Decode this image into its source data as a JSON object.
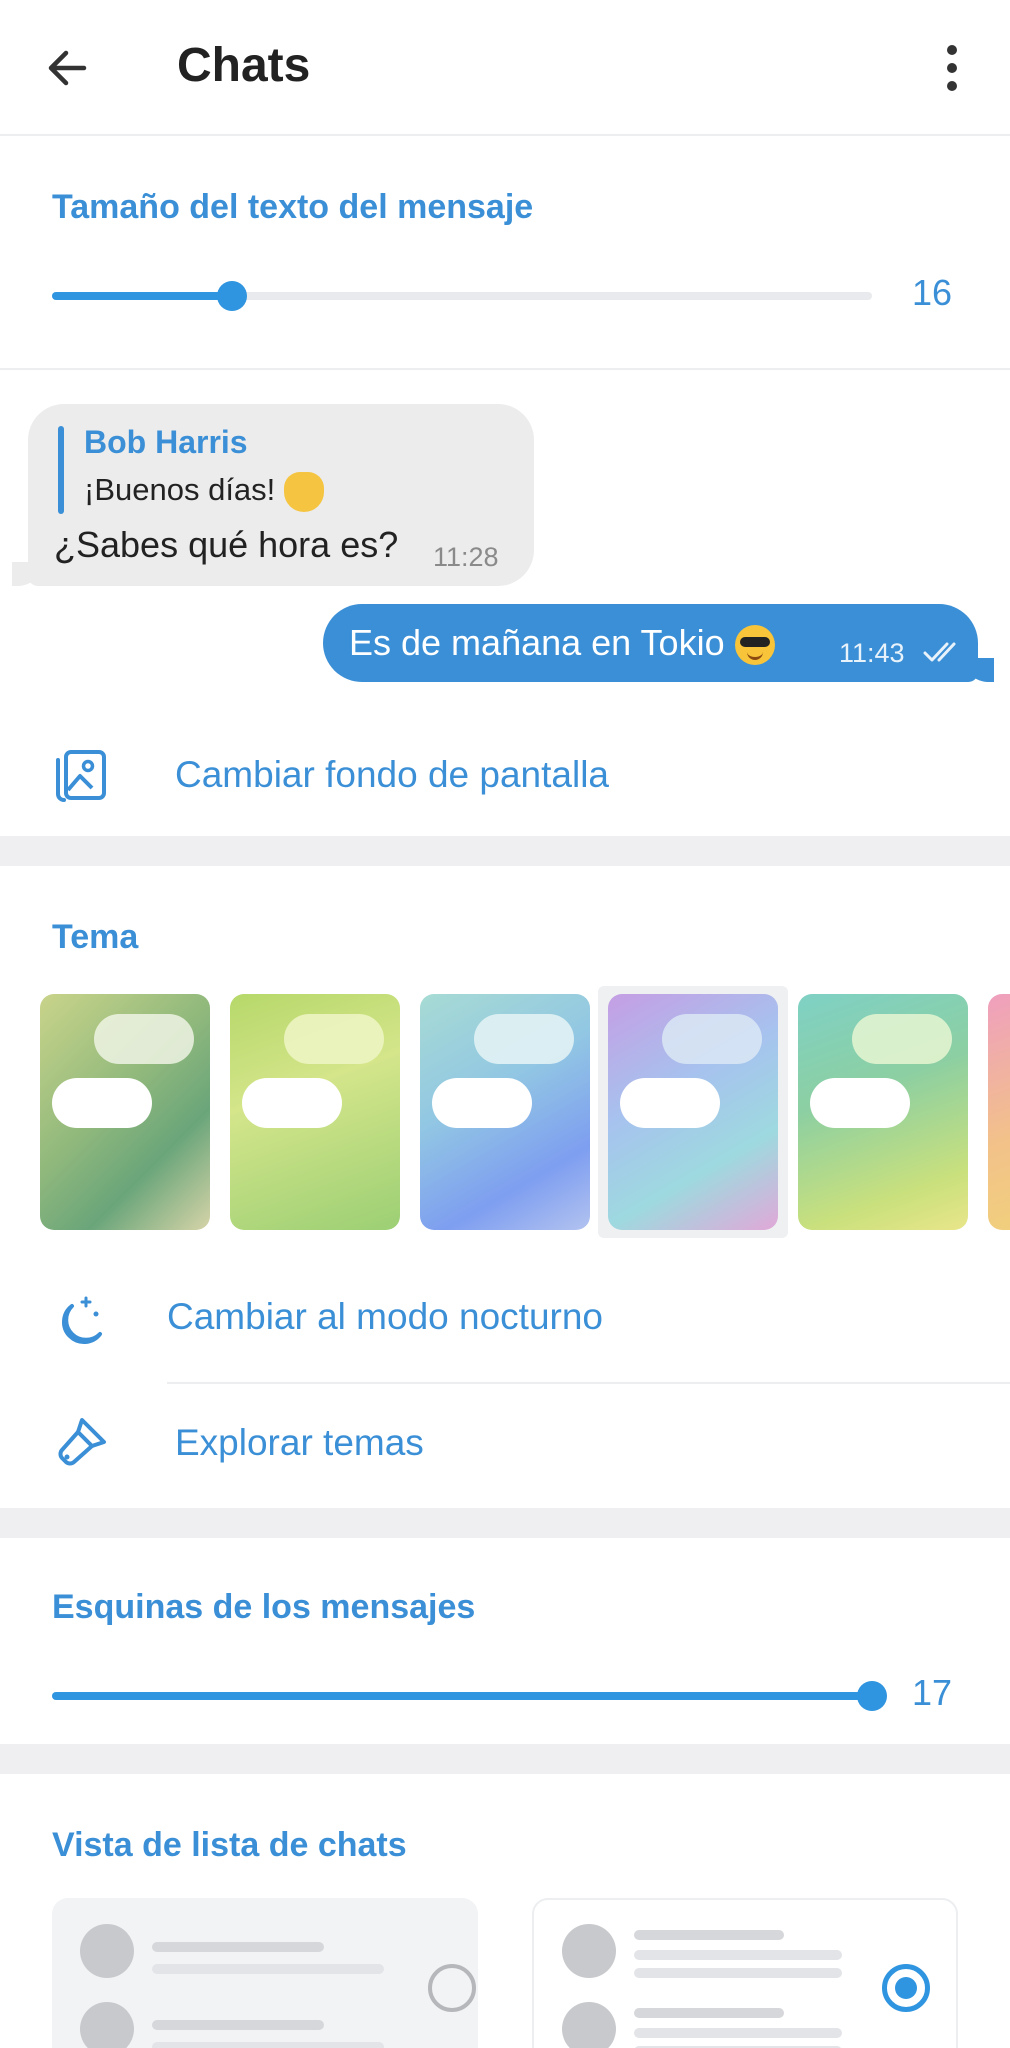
{
  "header": {
    "title": "Chats"
  },
  "text_size": {
    "title": "Tamaño del texto del mensaje",
    "value": "16",
    "fraction": 0.22
  },
  "preview": {
    "incoming": {
      "reply_name": "Bob Harris",
      "reply_text": "¡Buenos días!",
      "text": "¿Sabes qué hora es?",
      "time": "11:28"
    },
    "outgoing": {
      "text": "Es de mañana en Tokio",
      "time": "11:43"
    }
  },
  "wallpaper": {
    "label": "Cambiar fondo de pantalla"
  },
  "theme": {
    "title": "Tema",
    "selected_index": 3,
    "night_mode_label": "Cambiar al modo nocturno",
    "explore_label": "Explorar temas"
  },
  "corners": {
    "title": "Esquinas de los mensajes",
    "value": "17",
    "fraction": 1.0
  },
  "chat_list_view": {
    "title": "Vista de lista de chats",
    "selected_index": 1
  },
  "colors": {
    "accent": "#3a8fd6",
    "outgoing_bubble": "#3a8fd6",
    "incoming_bubble": "#ececec"
  }
}
